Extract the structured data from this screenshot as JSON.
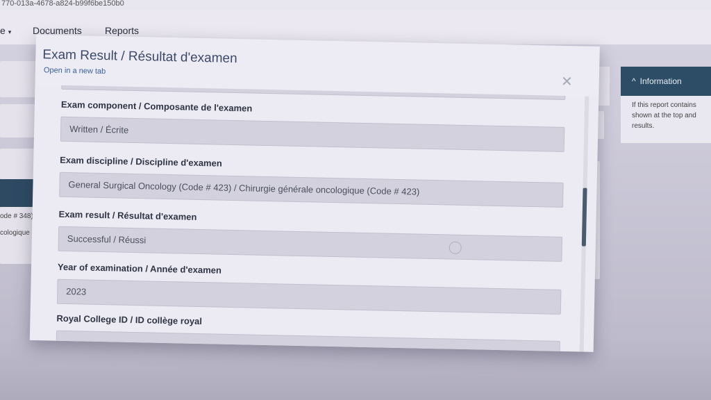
{
  "browser": {
    "url_fragment": "770-013a-4678-a824-b99f6be150b0"
  },
  "nav": {
    "partial_item": "e",
    "documents": "Documents",
    "reports": "Reports"
  },
  "background": {
    "left_text_1": "ode # 348)",
    "left_text_2": "cologique (Code"
  },
  "info_panel": {
    "title": "Information",
    "caret_icon": "chevron-up-icon",
    "body_lines": [
      "If this report contains",
      "shown at the top and",
      "results."
    ]
  },
  "modal": {
    "title": "Exam Result / Résultat d'examen",
    "open_link": "Open in a new tab",
    "close_icon": "close-icon",
    "fields": [
      {
        "label": "Exam component / Composante de l'examen",
        "value": "Written / Écrite"
      },
      {
        "label": "Exam discipline / Discipline d'examen",
        "value": "General Surgical Oncology (Code # 423) / Chirurgie générale oncologique (Code # 423)"
      },
      {
        "label": "Exam result / Résultat d'examen",
        "value": "Successful / Réussi"
      },
      {
        "label": "Year of examination / Année d'examen",
        "value": "2023"
      },
      {
        "label": "Royal College ID / ID collège royal",
        "value": ""
      }
    ]
  },
  "colors": {
    "header_dark": "#2d4c66",
    "modal_bg": "#eceaf2",
    "field_bg": "#d4d1de",
    "link": "#3a5f9a"
  }
}
